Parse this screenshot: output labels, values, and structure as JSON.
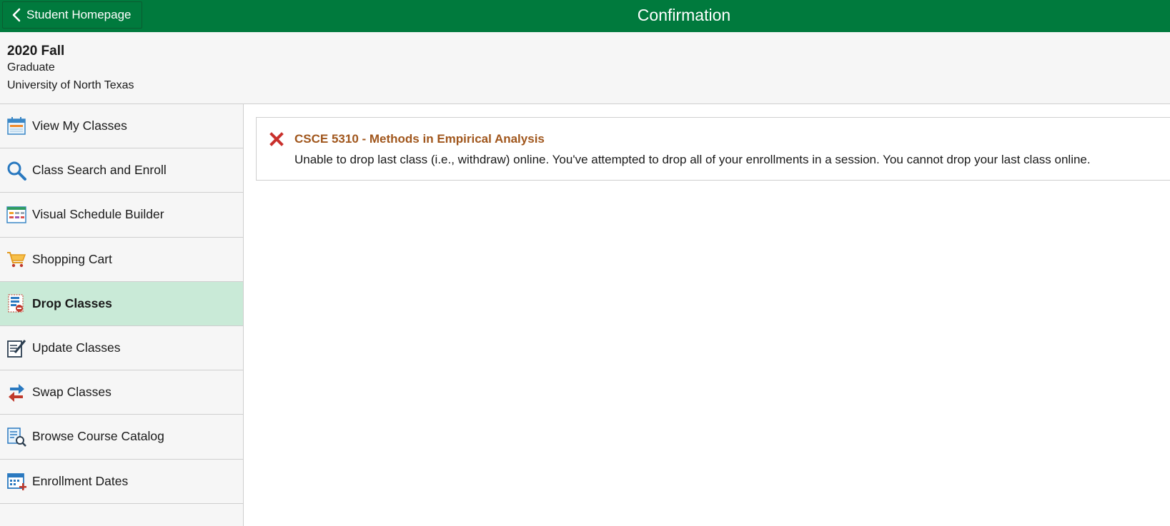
{
  "header": {
    "back_label": "Student Homepage",
    "title": "Confirmation",
    "brand_color": "#007a3d"
  },
  "context": {
    "term": "2020 Fall",
    "career": "Graduate",
    "institution": "University of North Texas"
  },
  "sidebar": {
    "items": [
      {
        "label": "View My Classes",
        "icon": "calendar-icon"
      },
      {
        "label": "Class Search and Enroll",
        "icon": "search-icon"
      },
      {
        "label": "Visual Schedule Builder",
        "icon": "schedule-builder-icon"
      },
      {
        "label": "Shopping Cart",
        "icon": "shopping-cart-icon"
      },
      {
        "label": "Drop Classes",
        "icon": "drop-classes-icon",
        "active": true
      },
      {
        "label": "Update Classes",
        "icon": "update-classes-icon"
      },
      {
        "label": "Swap Classes",
        "icon": "swap-arrows-icon"
      },
      {
        "label": "Browse Course Catalog",
        "icon": "catalog-search-icon"
      },
      {
        "label": "Enrollment Dates",
        "icon": "calendar-add-icon"
      }
    ]
  },
  "message": {
    "status": "error",
    "course": "CSCE 5310 - Methods in Empirical Analysis",
    "detail": "Unable to drop last class (i.e., withdraw) online. You've attempted to drop all of your enrollments in a session. You cannot drop your last class online."
  }
}
